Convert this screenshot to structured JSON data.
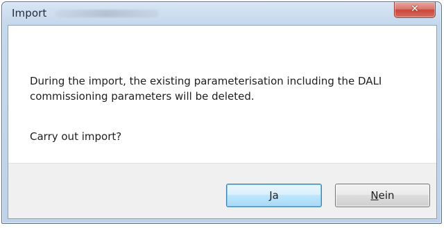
{
  "window": {
    "title": "Import"
  },
  "dialog": {
    "message": "During the import, the existing parameterisation including the DALI commissioning parameters will be deleted.",
    "question": "Carry out import?"
  },
  "buttons": {
    "yes_label": "Ja",
    "no_label_first": "N",
    "no_label_rest": "ein"
  },
  "icons": {
    "close": "close-icon"
  },
  "colors": {
    "title_bar": "#c6d8ec",
    "close_button": "#c9473d",
    "default_button_border": "#3c7fb1",
    "button_panel": "#f0f0f0"
  }
}
